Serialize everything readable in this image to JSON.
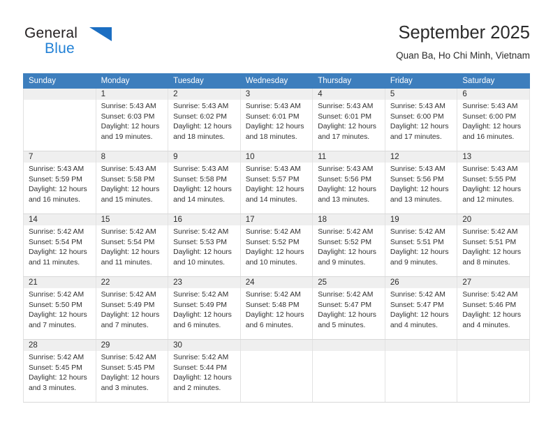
{
  "brand": {
    "name_dark": "General",
    "name_blue": "Blue",
    "accent_color": "#2281d6",
    "triangle_color": "#1b6ec2"
  },
  "header": {
    "title": "September 2025",
    "subtitle": "Quan Ba, Ho Chi Minh, Vietnam"
  },
  "calendar": {
    "header_bg": "#3d7ebd",
    "daynum_bg": "#efefef",
    "weekdays": [
      "Sunday",
      "Monday",
      "Tuesday",
      "Wednesday",
      "Thursday",
      "Friday",
      "Saturday"
    ],
    "weeks": [
      [
        {
          "day": "",
          "empty": true
        },
        {
          "day": "1",
          "sunrise": "Sunrise: 5:43 AM",
          "sunset": "Sunset: 6:03 PM",
          "daylight": "Daylight: 12 hours and 19 minutes."
        },
        {
          "day": "2",
          "sunrise": "Sunrise: 5:43 AM",
          "sunset": "Sunset: 6:02 PM",
          "daylight": "Daylight: 12 hours and 18 minutes."
        },
        {
          "day": "3",
          "sunrise": "Sunrise: 5:43 AM",
          "sunset": "Sunset: 6:01 PM",
          "daylight": "Daylight: 12 hours and 18 minutes."
        },
        {
          "day": "4",
          "sunrise": "Sunrise: 5:43 AM",
          "sunset": "Sunset: 6:01 PM",
          "daylight": "Daylight: 12 hours and 17 minutes."
        },
        {
          "day": "5",
          "sunrise": "Sunrise: 5:43 AM",
          "sunset": "Sunset: 6:00 PM",
          "daylight": "Daylight: 12 hours and 17 minutes."
        },
        {
          "day": "6",
          "sunrise": "Sunrise: 5:43 AM",
          "sunset": "Sunset: 6:00 PM",
          "daylight": "Daylight: 12 hours and 16 minutes."
        }
      ],
      [
        {
          "day": "7",
          "sunrise": "Sunrise: 5:43 AM",
          "sunset": "Sunset: 5:59 PM",
          "daylight": "Daylight: 12 hours and 16 minutes."
        },
        {
          "day": "8",
          "sunrise": "Sunrise: 5:43 AM",
          "sunset": "Sunset: 5:58 PM",
          "daylight": "Daylight: 12 hours and 15 minutes."
        },
        {
          "day": "9",
          "sunrise": "Sunrise: 5:43 AM",
          "sunset": "Sunset: 5:58 PM",
          "daylight": "Daylight: 12 hours and 14 minutes."
        },
        {
          "day": "10",
          "sunrise": "Sunrise: 5:43 AM",
          "sunset": "Sunset: 5:57 PM",
          "daylight": "Daylight: 12 hours and 14 minutes."
        },
        {
          "day": "11",
          "sunrise": "Sunrise: 5:43 AM",
          "sunset": "Sunset: 5:56 PM",
          "daylight": "Daylight: 12 hours and 13 minutes."
        },
        {
          "day": "12",
          "sunrise": "Sunrise: 5:43 AM",
          "sunset": "Sunset: 5:56 PM",
          "daylight": "Daylight: 12 hours and 13 minutes."
        },
        {
          "day": "13",
          "sunrise": "Sunrise: 5:43 AM",
          "sunset": "Sunset: 5:55 PM",
          "daylight": "Daylight: 12 hours and 12 minutes."
        }
      ],
      [
        {
          "day": "14",
          "sunrise": "Sunrise: 5:42 AM",
          "sunset": "Sunset: 5:54 PM",
          "daylight": "Daylight: 12 hours and 11 minutes."
        },
        {
          "day": "15",
          "sunrise": "Sunrise: 5:42 AM",
          "sunset": "Sunset: 5:54 PM",
          "daylight": "Daylight: 12 hours and 11 minutes."
        },
        {
          "day": "16",
          "sunrise": "Sunrise: 5:42 AM",
          "sunset": "Sunset: 5:53 PM",
          "daylight": "Daylight: 12 hours and 10 minutes."
        },
        {
          "day": "17",
          "sunrise": "Sunrise: 5:42 AM",
          "sunset": "Sunset: 5:52 PM",
          "daylight": "Daylight: 12 hours and 10 minutes."
        },
        {
          "day": "18",
          "sunrise": "Sunrise: 5:42 AM",
          "sunset": "Sunset: 5:52 PM",
          "daylight": "Daylight: 12 hours and 9 minutes."
        },
        {
          "day": "19",
          "sunrise": "Sunrise: 5:42 AM",
          "sunset": "Sunset: 5:51 PM",
          "daylight": "Daylight: 12 hours and 9 minutes."
        },
        {
          "day": "20",
          "sunrise": "Sunrise: 5:42 AM",
          "sunset": "Sunset: 5:51 PM",
          "daylight": "Daylight: 12 hours and 8 minutes."
        }
      ],
      [
        {
          "day": "21",
          "sunrise": "Sunrise: 5:42 AM",
          "sunset": "Sunset: 5:50 PM",
          "daylight": "Daylight: 12 hours and 7 minutes."
        },
        {
          "day": "22",
          "sunrise": "Sunrise: 5:42 AM",
          "sunset": "Sunset: 5:49 PM",
          "daylight": "Daylight: 12 hours and 7 minutes."
        },
        {
          "day": "23",
          "sunrise": "Sunrise: 5:42 AM",
          "sunset": "Sunset: 5:49 PM",
          "daylight": "Daylight: 12 hours and 6 minutes."
        },
        {
          "day": "24",
          "sunrise": "Sunrise: 5:42 AM",
          "sunset": "Sunset: 5:48 PM",
          "daylight": "Daylight: 12 hours and 6 minutes."
        },
        {
          "day": "25",
          "sunrise": "Sunrise: 5:42 AM",
          "sunset": "Sunset: 5:47 PM",
          "daylight": "Daylight: 12 hours and 5 minutes."
        },
        {
          "day": "26",
          "sunrise": "Sunrise: 5:42 AM",
          "sunset": "Sunset: 5:47 PM",
          "daylight": "Daylight: 12 hours and 4 minutes."
        },
        {
          "day": "27",
          "sunrise": "Sunrise: 5:42 AM",
          "sunset": "Sunset: 5:46 PM",
          "daylight": "Daylight: 12 hours and 4 minutes."
        }
      ],
      [
        {
          "day": "28",
          "sunrise": "Sunrise: 5:42 AM",
          "sunset": "Sunset: 5:45 PM",
          "daylight": "Daylight: 12 hours and 3 minutes."
        },
        {
          "day": "29",
          "sunrise": "Sunrise: 5:42 AM",
          "sunset": "Sunset: 5:45 PM",
          "daylight": "Daylight: 12 hours and 3 minutes."
        },
        {
          "day": "30",
          "sunrise": "Sunrise: 5:42 AM",
          "sunset": "Sunset: 5:44 PM",
          "daylight": "Daylight: 12 hours and 2 minutes."
        },
        {
          "day": "",
          "empty": true
        },
        {
          "day": "",
          "empty": true
        },
        {
          "day": "",
          "empty": true
        },
        {
          "day": "",
          "empty": true
        }
      ]
    ]
  }
}
